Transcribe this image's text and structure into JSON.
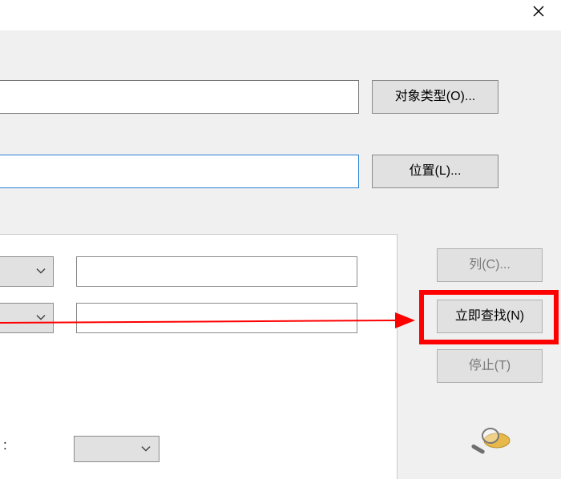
{
  "titlebar": {
    "close_label": "✕"
  },
  "top": {
    "input1_value": "",
    "obj_type_btn": "对象类型(O)...",
    "input2_value": "",
    "location_btn": "位置(L)..."
  },
  "conditions": {
    "combo1_value": "",
    "combo2_value": "",
    "input1_value": "",
    "input2_value": ""
  },
  "bottom": {
    "colon": ":",
    "combo_value": ""
  },
  "right": {
    "columns_btn": "列(C)...",
    "findnow_btn": "立即查找(N)",
    "stop_btn": "停止(T)"
  },
  "icons": {
    "close": "close-icon",
    "chevron_down": "chevron-down-icon",
    "magnifier": "magnifier-icon"
  }
}
